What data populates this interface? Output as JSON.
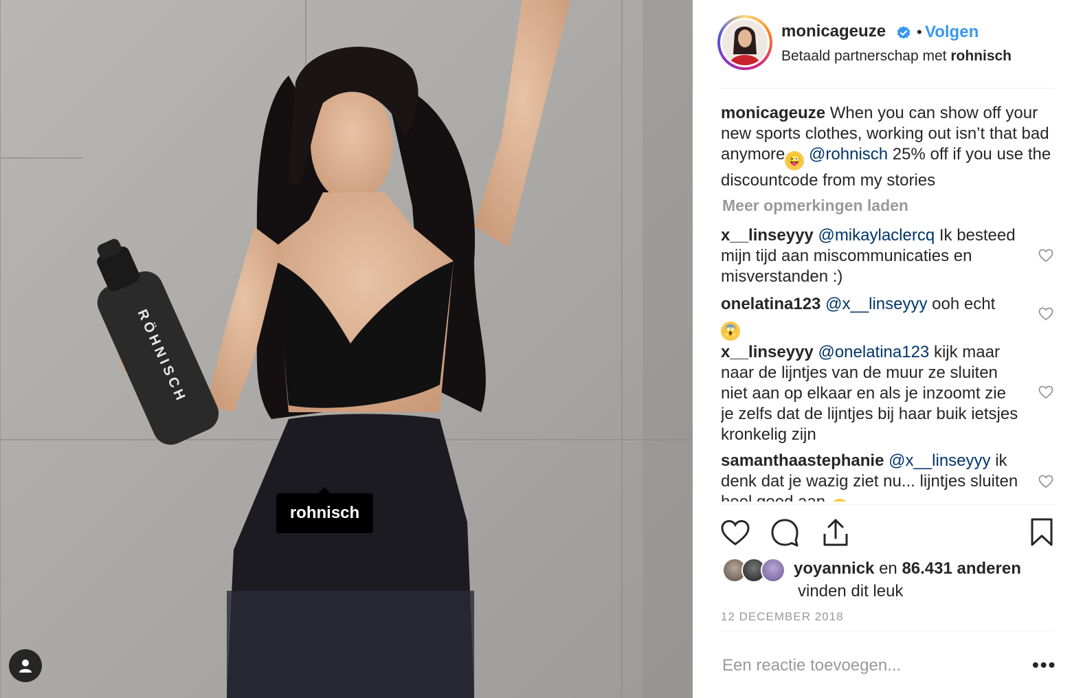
{
  "photo": {
    "tag_label": "rohnisch",
    "bottle_text": "RÖHNISCH",
    "user_tags_icon": "user-silhouette-icon"
  },
  "header": {
    "username": "monicageuze",
    "verified_icon": "verified-badge-icon",
    "separator": "•",
    "follow_label": "Volgen",
    "partnership_prefix": "Betaald partnerschap met",
    "partner": "rohnisch"
  },
  "caption": {
    "username": "monicageuze",
    "text_1": "When you can show off your new sports clothes, working out isn’t that bad anymore",
    "emoji_1": "😜",
    "mention": "@rohnisch",
    "text_2": "25% off if you use the discountcode from my stories"
  },
  "load_more": "Meer opmerkingen laden",
  "comments": [
    {
      "username": "x__linseyyy",
      "mention": "@mikaylaclercq",
      "text": "Ik besteed mijn tijd aan miscommunicaties en misverstanden :)",
      "emoji": ""
    },
    {
      "username": "onelatina123",
      "mention": "@x__linseyyy",
      "text": "ooh echt",
      "emoji": "😱"
    },
    {
      "username": "x__linseyyy",
      "mention": "@onelatina123",
      "text": "kijk maar naar de lijntjes van de muur ze sluiten niet aan op elkaar en als je inzoomt zie je zelfs dat de lijntjes bij haar buik ietsjes kronkelig zijn",
      "emoji": ""
    },
    {
      "username": "samanthaastephanie",
      "mention": "@x__linseyyy",
      "text": "ik denk dat je wazig ziet nu... lijntjes sluiten heel goed aan",
      "emoji": "😅"
    }
  ],
  "likes": {
    "user": "yoyannick",
    "connector": "en",
    "count": "86.431 anderen",
    "suffix": "vinden dit leuk"
  },
  "date": "12 DECEMBER 2018",
  "add_comment_placeholder": "Een reactie toevoegen...",
  "more_options": "•••",
  "colors": {
    "link": "#3897f0",
    "mention": "#003569",
    "muted": "#999999",
    "text": "#262626"
  }
}
